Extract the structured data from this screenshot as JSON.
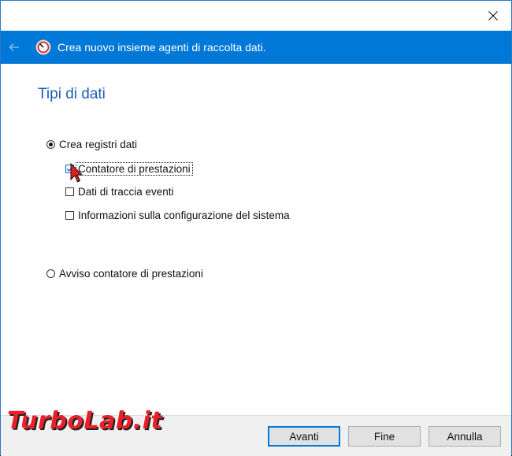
{
  "window": {
    "title": "Crea nuovo insieme agenti di raccolta dati.",
    "close_icon": "close-icon",
    "back_icon": "back-arrow-icon"
  },
  "page": {
    "title": "Tipi di dati"
  },
  "options": {
    "create_logs": {
      "label": "Crea registri dati",
      "selected": true
    },
    "sub_items": [
      {
        "label": "Contatore di prestazioni",
        "checked": true
      },
      {
        "label": "Dati di traccia eventi",
        "checked": false
      },
      {
        "label": "Informazioni sulla configurazione del sistema",
        "checked": false
      }
    ],
    "alert": {
      "label": "Avviso contatore di prestazioni",
      "selected": false
    }
  },
  "buttons": {
    "next": "Avanti",
    "finish": "Fine",
    "cancel": "Annulla"
  },
  "watermark": "TurboLab.it",
  "colors": {
    "header": "#0078d7",
    "title": "#1b5fb4",
    "watermark": "#e8202a"
  }
}
